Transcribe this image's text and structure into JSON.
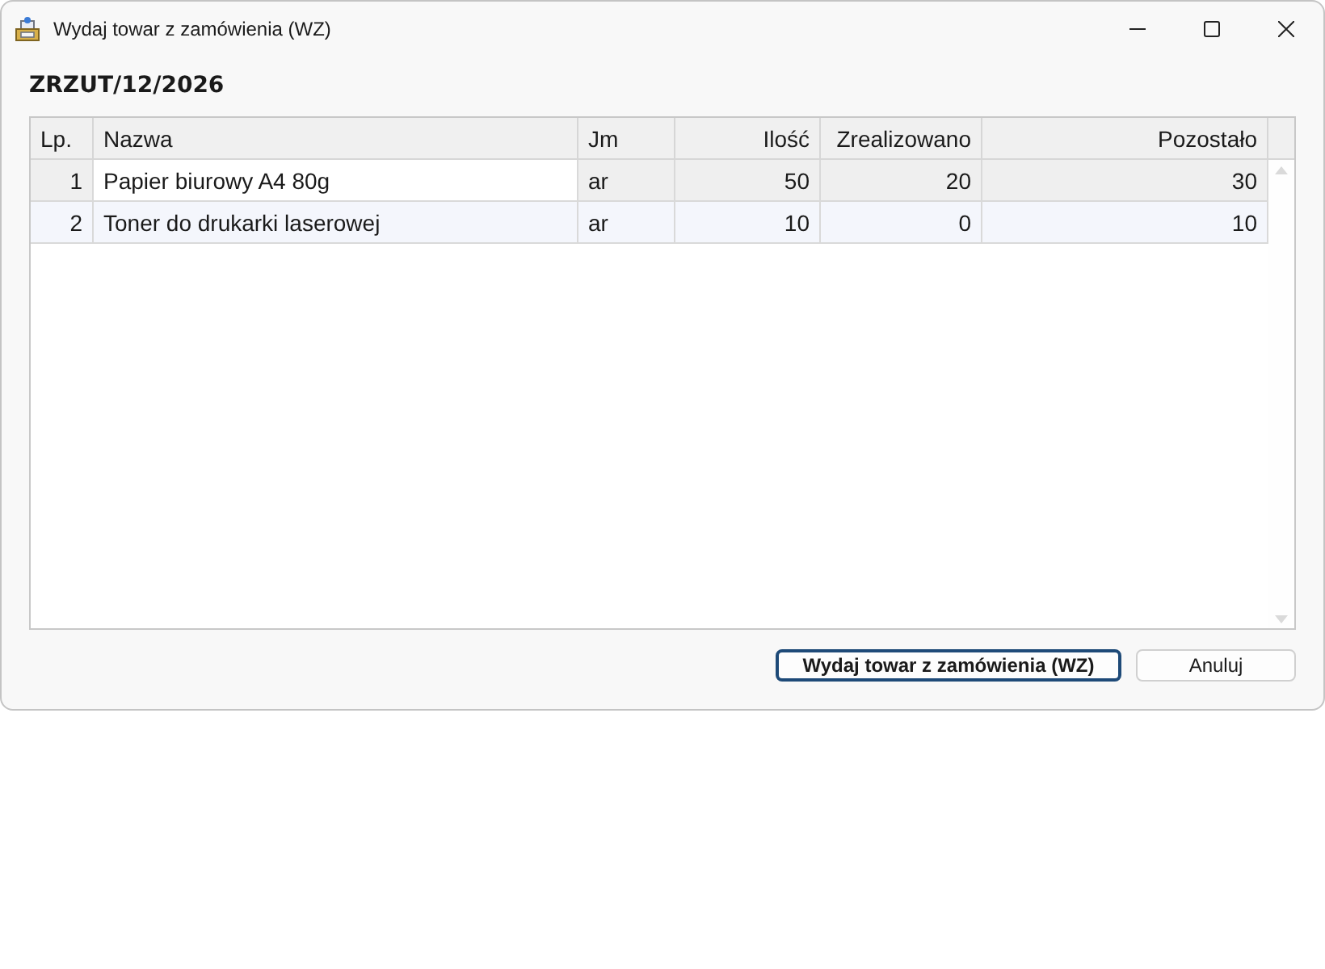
{
  "window": {
    "title": "Wydaj towar z zamówienia (WZ)"
  },
  "document": {
    "number": "ZRZUT/12/2026"
  },
  "table": {
    "columns": [
      {
        "label": "Lp.",
        "kind": "index",
        "focused": false
      },
      {
        "label": "Nazwa",
        "kind": "text",
        "focused": true
      },
      {
        "label": "Jm",
        "kind": "text",
        "focused": false
      },
      {
        "label": "Ilość",
        "kind": "number",
        "focused": false
      },
      {
        "label": "Zrealizowano",
        "kind": "number",
        "focused": false
      },
      {
        "label": "Pozostało",
        "kind": "number",
        "focused": false
      }
    ],
    "rows": [
      {
        "selected": true,
        "cells": [
          "1",
          "Papier biurowy A4 80g",
          "ar",
          "50",
          "20",
          "30"
        ]
      },
      {
        "selected": false,
        "cells": [
          "2",
          "Toner do drukarki laserowej",
          "ar",
          "10",
          "0",
          "10"
        ]
      }
    ]
  },
  "buttons": [
    {
      "label": "Wydaj towar z zamówienia (WZ)",
      "default": true
    },
    {
      "label": "Anuluj",
      "default": false
    }
  ]
}
